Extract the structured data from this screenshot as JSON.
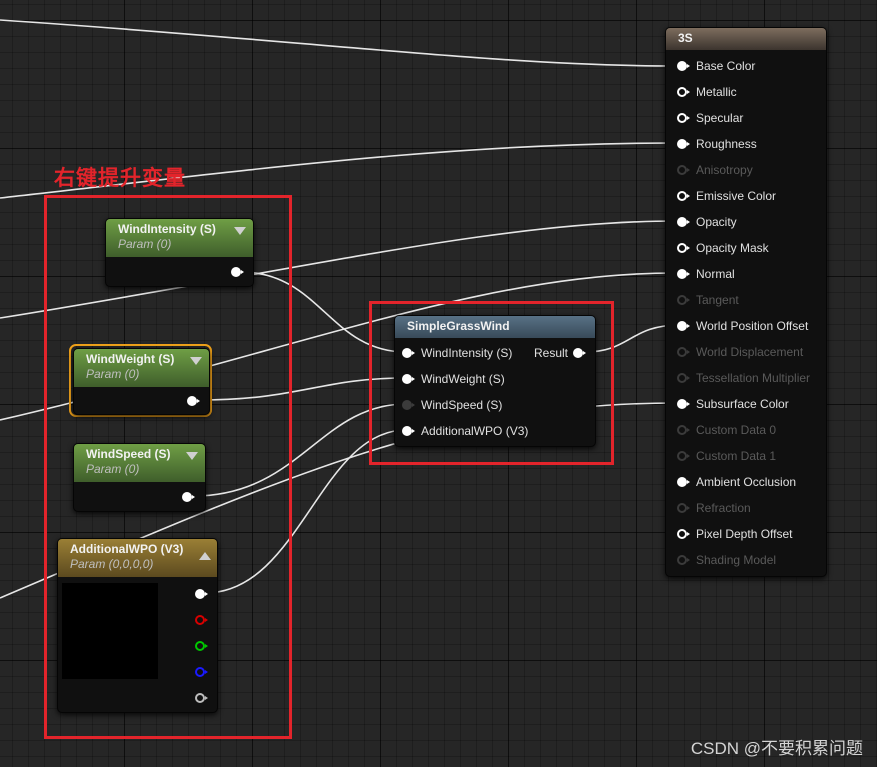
{
  "annotation": {
    "text": "右键提升变量"
  },
  "nodes": {
    "wind_intensity": {
      "title": "WindIntensity (S)",
      "subtitle": "Param (0)"
    },
    "wind_weight": {
      "title": "WindWeight (S)",
      "subtitle": "Param (0)"
    },
    "wind_speed": {
      "title": "WindSpeed (S)",
      "subtitle": "Param (0)"
    },
    "additional_wpo": {
      "title": "AdditionalWPO (V3)",
      "subtitle": "Param (0,0,0,0)"
    },
    "simple_grass_wind": {
      "title": "SimpleGrassWind",
      "inputs": [
        "WindIntensity (S)",
        "WindWeight (S)",
        "WindSpeed (S)",
        "AdditionalWPO (V3)"
      ],
      "output": "Result"
    },
    "material": {
      "title": "3S",
      "inputs": [
        "Base Color",
        "Metallic",
        "Specular",
        "Roughness",
        "Anisotropy",
        "Emissive Color",
        "Opacity",
        "Opacity Mask",
        "Normal",
        "Tangent",
        "World Position Offset",
        "World Displacement",
        "Tessellation Multiplier",
        "Subsurface Color",
        "Custom Data 0",
        "Custom Data 1",
        "Ambient Occlusion",
        "Refraction",
        "Pixel Depth Offset",
        "Shading Model"
      ]
    }
  },
  "watermark": "CSDN @不要积累问题",
  "colors": {
    "annotation_red": "#e3242b",
    "selection_orange": "#f2a31a",
    "wire": "#e6e6e6"
  }
}
